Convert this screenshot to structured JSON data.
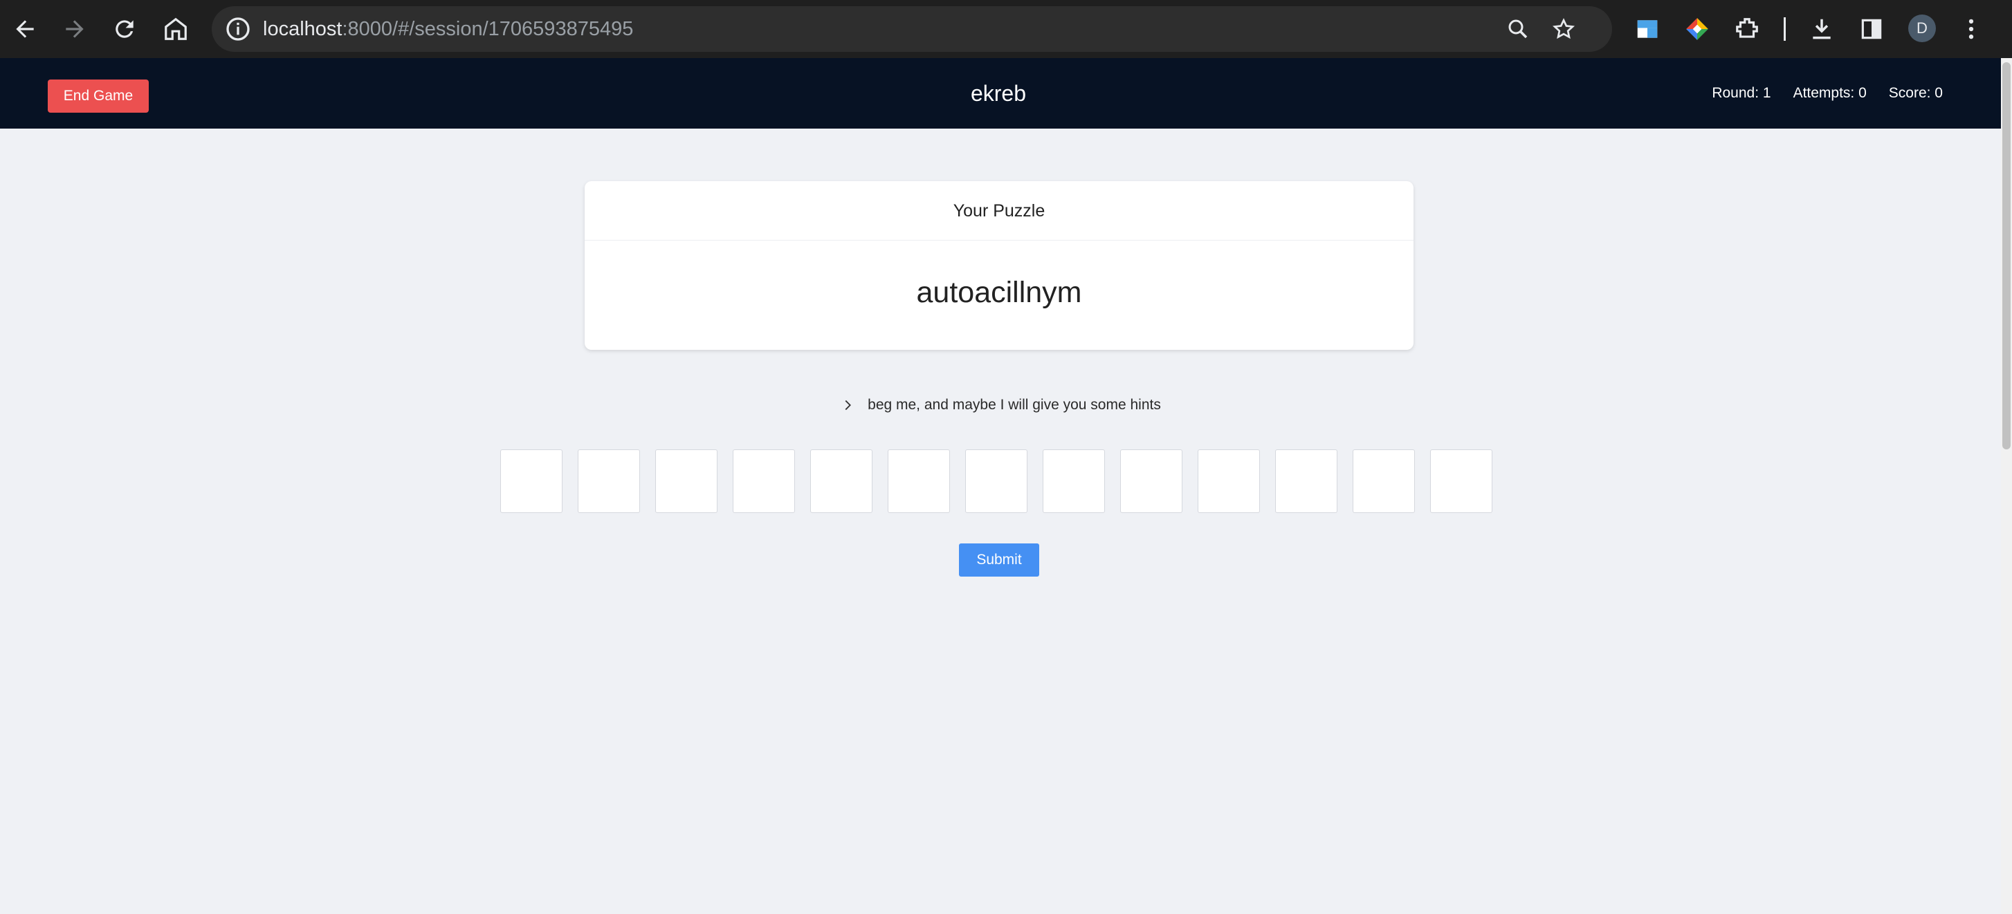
{
  "browser": {
    "url_host": "localhost",
    "url_rest": ":8000/#/session/1706593875495",
    "avatar_letter": "D",
    "icons": [
      "back-arrow-icon",
      "forward-arrow-icon",
      "reload-icon",
      "home-icon",
      "site-info-icon",
      "zoom-icon",
      "star-icon",
      "extension-icon",
      "color-extension-icon",
      "puzzle-extensions-icon",
      "download-icon",
      "side-panel-icon",
      "more-menu-icon"
    ]
  },
  "header": {
    "end_game_label": "End Game",
    "title": "ekreb",
    "round_label": "Round: 1",
    "attempts_label": "Attempts: 0",
    "score_label": "Score: 0",
    "end_button_color": "#ec5050",
    "background_color": "#071224"
  },
  "puzzle": {
    "heading": "Your Puzzle",
    "scrambled_word": "autoacillnym"
  },
  "hint": {
    "text": "beg me, and maybe I will give you some hints"
  },
  "answer_boxes": {
    "count": 13,
    "values": [
      "",
      "",
      "",
      "",
      "",
      "",
      "",
      "",
      "",
      "",
      "",
      "",
      ""
    ]
  },
  "submit_label": "Submit",
  "accent_color": "#4590f3"
}
